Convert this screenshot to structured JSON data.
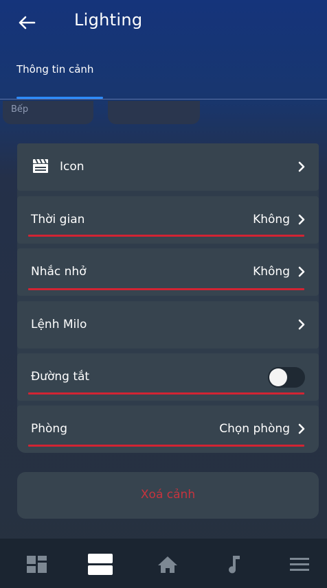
{
  "header": {
    "title": "Lighting",
    "back_icon": "arrow-left-icon"
  },
  "tabs": [
    {
      "label": "Thông tin cảnh",
      "active": true
    }
  ],
  "chips": [
    {
      "label": "Bếp"
    },
    {
      "label": ""
    }
  ],
  "rows": {
    "icon": {
      "label": "Icon",
      "icon": "clapperboard-icon"
    },
    "time": {
      "label": "Thời gian",
      "value": "Không"
    },
    "reminder": {
      "label": "Nhắc nhở",
      "value": "Không"
    },
    "milo": {
      "label": "Lệnh Milo"
    },
    "shortcut": {
      "label": "Đường tắt",
      "enabled": false
    },
    "room": {
      "label": "Phòng",
      "value": "Chọn phòng"
    }
  },
  "delete": {
    "label": "Xoá cảnh"
  },
  "bottom_nav": [
    {
      "icon": "dashboard-icon"
    },
    {
      "icon": "scenes-icon",
      "active": true
    },
    {
      "icon": "home-icon"
    },
    {
      "icon": "music-icon"
    },
    {
      "icon": "menu-icon"
    }
  ],
  "colors": {
    "accent": "#2c8bff",
    "danger": "#c7343e",
    "highlight": "#d22433"
  }
}
